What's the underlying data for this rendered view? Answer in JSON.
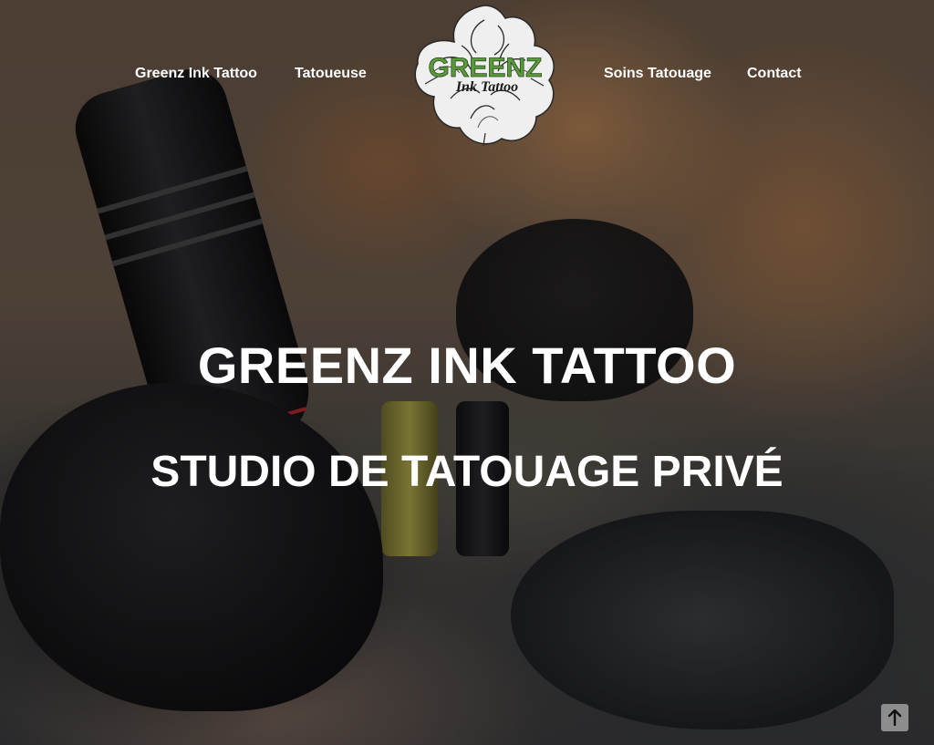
{
  "nav": {
    "items": [
      {
        "label": "Greenz Ink Tattoo"
      },
      {
        "label": "Tatoueuse"
      },
      {
        "label": "Soins Tatouage"
      },
      {
        "label": "Contact"
      }
    ],
    "logo": {
      "text_top": "GREENZ",
      "text_bottom": "Ink Tattoo",
      "icon": "peony-flower-logo",
      "accent_color": "#5a9a3c"
    }
  },
  "hero": {
    "title": "GREENZ INK TATTOO",
    "subtitle": "STUDIO DE TATOUAGE PRIVÉ"
  },
  "scroll_top": {
    "icon": "arrow-up-icon"
  }
}
